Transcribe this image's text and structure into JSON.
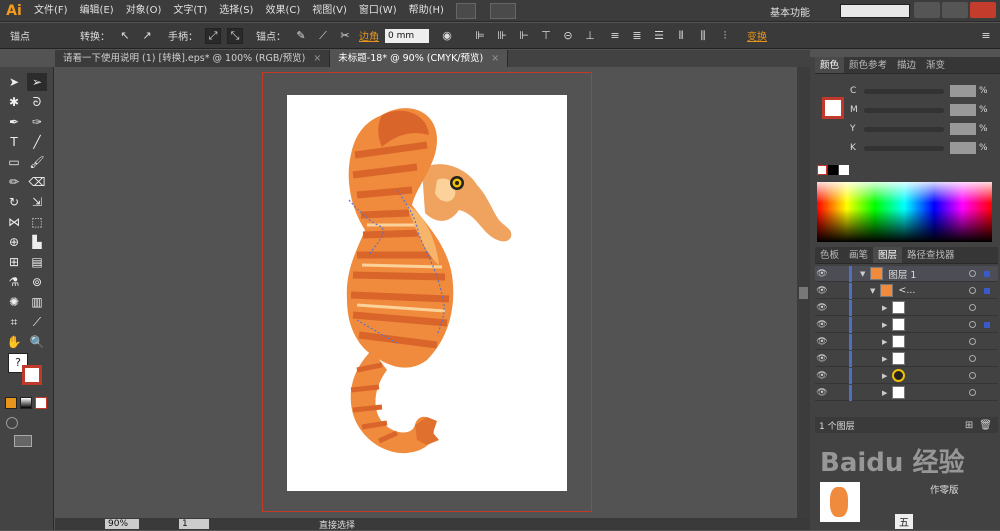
{
  "app": {
    "logo": "Ai",
    "workspace": "基本功能"
  },
  "menu": [
    "文件(F)",
    "编辑(E)",
    "对象(O)",
    "文字(T)",
    "选择(S)",
    "效果(C)",
    "视图(V)",
    "窗口(W)",
    "帮助(H)"
  ],
  "control_bar": {
    "anchor_label": "锚点",
    "convert_label": "转换：",
    "handle_label": "手柄：",
    "anchor_points_label": "锚点：",
    "corner_label": "边角",
    "corner_value": "0 mm",
    "transform_label": "变换"
  },
  "tabs": [
    {
      "label": "请看一下使用说明 (1) [转换].eps* @ 100% (RGB/预览)",
      "close": "×",
      "active": false
    },
    {
      "label": "未标题-18* @ 90% (CMYK/预览)",
      "close": "×",
      "active": true
    }
  ],
  "status": {
    "zoom": "90%",
    "page": "1",
    "tool": "直接选择"
  },
  "color_panel": {
    "tabs": [
      "颜色",
      "颜色参考",
      "描边",
      "渐变"
    ],
    "channels": [
      {
        "label": "C",
        "pct": "%"
      },
      {
        "label": "M",
        "pct": "%"
      },
      {
        "label": "Y",
        "pct": "%"
      },
      {
        "label": "K",
        "pct": "%"
      }
    ]
  },
  "layers_panel": {
    "tabs": [
      "色板",
      "画笔",
      "图层",
      "路径查找器"
    ],
    "layer_name": "图层 1",
    "group_name": "<...",
    "footer": "1 个图层"
  },
  "extra": {
    "artboard_button": "作零版",
    "watermark": "Baidu 经验",
    "ime": "五"
  },
  "colors": {
    "accent": "#e8951e",
    "menu_bg": "#3c3c3c",
    "panel_bg": "#424242",
    "canvas_bg": "#535353",
    "layer_bar": "#4f6fbf"
  }
}
